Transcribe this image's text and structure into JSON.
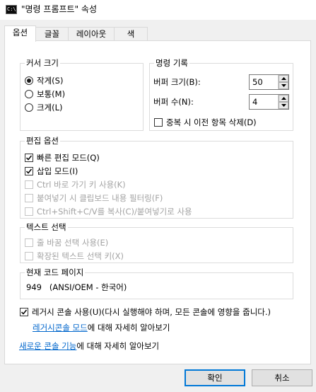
{
  "window": {
    "title": "\"명령 프롬프트\" 속성"
  },
  "tabs": [
    {
      "label": "옵션"
    },
    {
      "label": "글꼴"
    },
    {
      "label": "레이아웃"
    },
    {
      "label": "색"
    }
  ],
  "cursor_size": {
    "title": "커서 크기",
    "options": [
      {
        "label": "작게(S)",
        "selected": true
      },
      {
        "label": "보통(M)",
        "selected": false
      },
      {
        "label": "크게(L)",
        "selected": false
      }
    ]
  },
  "command_history": {
    "title": "명령 기록",
    "buffer_size_label": "버퍼 크기(B):",
    "buffer_size_value": "50",
    "buffer_count_label": "버퍼 수(N):",
    "buffer_count_value": "4",
    "discard_duplicates_label": "중복 시 이전 항목 삭제(D)",
    "discard_duplicates_checked": false
  },
  "edit_options": {
    "title": "편집 옵션",
    "items": [
      {
        "label": "빠른 편집 모드(Q)",
        "checked": true,
        "enabled": true
      },
      {
        "label": "삽입 모드(I)",
        "checked": true,
        "enabled": true
      },
      {
        "label": "Ctrl 바로 가기 키 사용(K)",
        "checked": false,
        "enabled": false
      },
      {
        "label": "붙여넣기 시 클립보드 내용 필터링(F)",
        "checked": false,
        "enabled": false
      },
      {
        "label": "Ctrl+Shift+C/V를 복사(C)/붙여넣기로 사용",
        "checked": false,
        "enabled": false
      }
    ]
  },
  "text_selection": {
    "title": "텍스트 선택",
    "items": [
      {
        "label": "줄 바꿈 선택 사용(E)",
        "checked": false,
        "enabled": false
      },
      {
        "label": "확장된 텍스트 선택 키(X)",
        "checked": false,
        "enabled": false
      }
    ]
  },
  "code_page": {
    "title": "현재 코드 페이지",
    "value": "949   (ANSI/OEM - 한국어)"
  },
  "legacy": {
    "label": "레거시 콘솔 사용(U)(다시 실행해야 하며, 모든 콘솔에 영향을 줍니다.)",
    "checked": true,
    "link_text": "레거시콘솔 모드",
    "link_suffix": "에 대해 자세히 알아보기"
  },
  "new_console": {
    "link_text": "새로운 콘솔 기능",
    "link_suffix": "에 대해 자세히 알아보기"
  },
  "buttons": {
    "ok": "확인",
    "cancel": "취소"
  }
}
